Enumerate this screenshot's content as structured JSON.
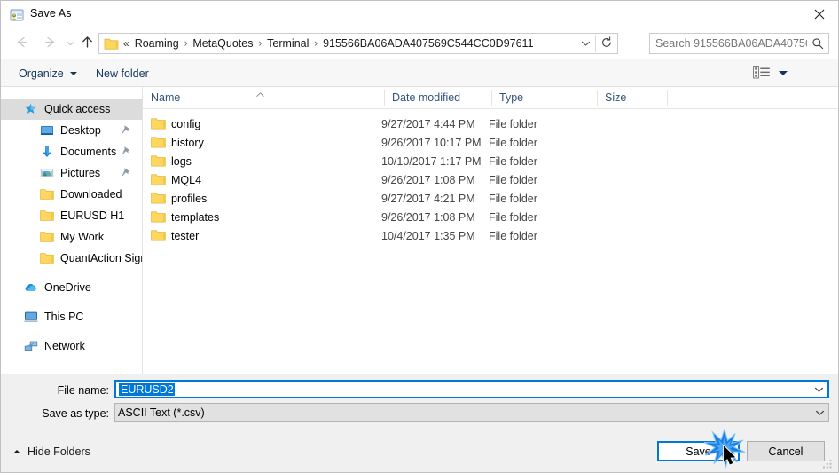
{
  "window": {
    "title": "Save As",
    "title_icon": "save-as-app-icon",
    "close_icon": "close-icon"
  },
  "navigation": {
    "back_icon": "arrow-left-icon",
    "forward_icon": "arrow-right-icon",
    "recent_icon": "chevron-down-icon",
    "up_icon": "arrow-up-icon",
    "address": {
      "folder_icon": "folder-icon",
      "separator_prefix": "«",
      "crumbs": [
        "Roaming",
        "MetaQuotes",
        "Terminal",
        "915566BA06ADA407569C544CC0D97611"
      ],
      "separator": "›",
      "dropdown_icon": "chevron-down-icon",
      "refresh_icon": "refresh-icon"
    },
    "search": {
      "placeholder": "Search 915566BA06ADA40756...",
      "icon": "search-icon"
    }
  },
  "commandbar": {
    "organize_label": "Organize",
    "new_folder_label": "New folder",
    "view_icon": "view-layout-icon",
    "view_caret_icon": "chevron-down-icon",
    "help_icon": "help-question-icon"
  },
  "sidebar": {
    "items": [
      {
        "label": "Quick access",
        "icon": "star-pin-icon",
        "level": 0,
        "selected": true,
        "pinned": false
      },
      {
        "label": "Desktop",
        "icon": "desktop-monitor-icon",
        "level": 1,
        "selected": false,
        "pinned": true
      },
      {
        "label": "Documents",
        "icon": "documents-arrow-icon",
        "level": 1,
        "selected": false,
        "pinned": true
      },
      {
        "label": "Pictures",
        "icon": "pictures-image-icon",
        "level": 1,
        "selected": false,
        "pinned": true
      },
      {
        "label": "Downloaded",
        "icon": "folder-icon",
        "level": 1,
        "selected": false,
        "pinned": false
      },
      {
        "label": "EURUSD H1",
        "icon": "folder-icon",
        "level": 1,
        "selected": false,
        "pinned": false
      },
      {
        "label": "My Work",
        "icon": "folder-icon",
        "level": 1,
        "selected": false,
        "pinned": false
      },
      {
        "label": "QuantAction Signal",
        "icon": "folder-icon",
        "level": 1,
        "selected": false,
        "pinned": false
      },
      {
        "label": "OneDrive",
        "icon": "onedrive-cloud-icon",
        "level": 0,
        "selected": false,
        "pinned": false,
        "gap_before": true
      },
      {
        "label": "This PC",
        "icon": "this-pc-monitor-icon",
        "level": 0,
        "selected": false,
        "pinned": false,
        "gap_before": true
      },
      {
        "label": "Network",
        "icon": "network-icon",
        "level": 0,
        "selected": false,
        "pinned": false,
        "gap_before": true
      }
    ]
  },
  "filelist": {
    "columns": [
      {
        "label": "Name",
        "sorted": "asc"
      },
      {
        "label": "Date modified",
        "sorted": ""
      },
      {
        "label": "Type",
        "sorted": ""
      },
      {
        "label": "Size",
        "sorted": ""
      }
    ],
    "rows": [
      {
        "name": "config",
        "date": "9/27/2017 4:44 PM",
        "type": "File folder",
        "size": "",
        "icon": "folder-icon"
      },
      {
        "name": "history",
        "date": "9/26/2017 10:17 PM",
        "type": "File folder",
        "size": "",
        "icon": "folder-icon"
      },
      {
        "name": "logs",
        "date": "10/10/2017 1:17 PM",
        "type": "File folder",
        "size": "",
        "icon": "folder-icon"
      },
      {
        "name": "MQL4",
        "date": "9/26/2017 1:08 PM",
        "type": "File folder",
        "size": "",
        "icon": "folder-icon"
      },
      {
        "name": "profiles",
        "date": "9/27/2017 4:21 PM",
        "type": "File folder",
        "size": "",
        "icon": "folder-icon"
      },
      {
        "name": "templates",
        "date": "9/26/2017 1:08 PM",
        "type": "File folder",
        "size": "",
        "icon": "folder-icon"
      },
      {
        "name": "tester",
        "date": "10/4/2017 1:35 PM",
        "type": "File folder",
        "size": "",
        "icon": "folder-icon"
      }
    ]
  },
  "form": {
    "filename_label": "File name:",
    "filename_value": "EURUSD2",
    "filename_selected": true,
    "savetype_label": "Save as type:",
    "savetype_value": "ASCII Text (*.csv)",
    "dropdown_icon": "chevron-down-icon"
  },
  "footer": {
    "hide_folders_label": "Hide Folders",
    "hide_folders_icon": "chevron-up-icon",
    "save_label": "Save",
    "cancel_label": "Cancel",
    "resize_grip_icon": "resize-grip-icon",
    "cursor_icon": "mouse-cursor-arrow-icon",
    "click_indicator_icon": "click-burst-icon"
  },
  "colors": {
    "accent": "#0078d7",
    "folder_yellow": "#ffd75e",
    "header_text": "#34537a",
    "command_text": "#14375e",
    "selection_gray": "#dcdcdc"
  }
}
